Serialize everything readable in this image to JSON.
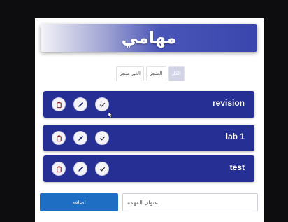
{
  "header": {
    "title": "مهامي"
  },
  "filters": [
    {
      "label": "الكل",
      "active": true
    },
    {
      "label": "المنجز",
      "active": false
    },
    {
      "label": "الغير منجز",
      "active": false
    }
  ],
  "tasks": [
    {
      "title": "revision"
    },
    {
      "title": "lab 1"
    },
    {
      "title": "test"
    }
  ],
  "task_actions": [
    "delete-icon",
    "edit-icon",
    "check-icon"
  ],
  "form": {
    "input_placeholder": "عنوان المهمه",
    "add_label": "اضافة"
  },
  "colors": {
    "task_bg": "#262f94",
    "add_button": "#1e6fc4",
    "delete_icon": "#8b1a1a",
    "edit_icon": "#1e2a78",
    "check_icon": "#2a2a2a"
  }
}
